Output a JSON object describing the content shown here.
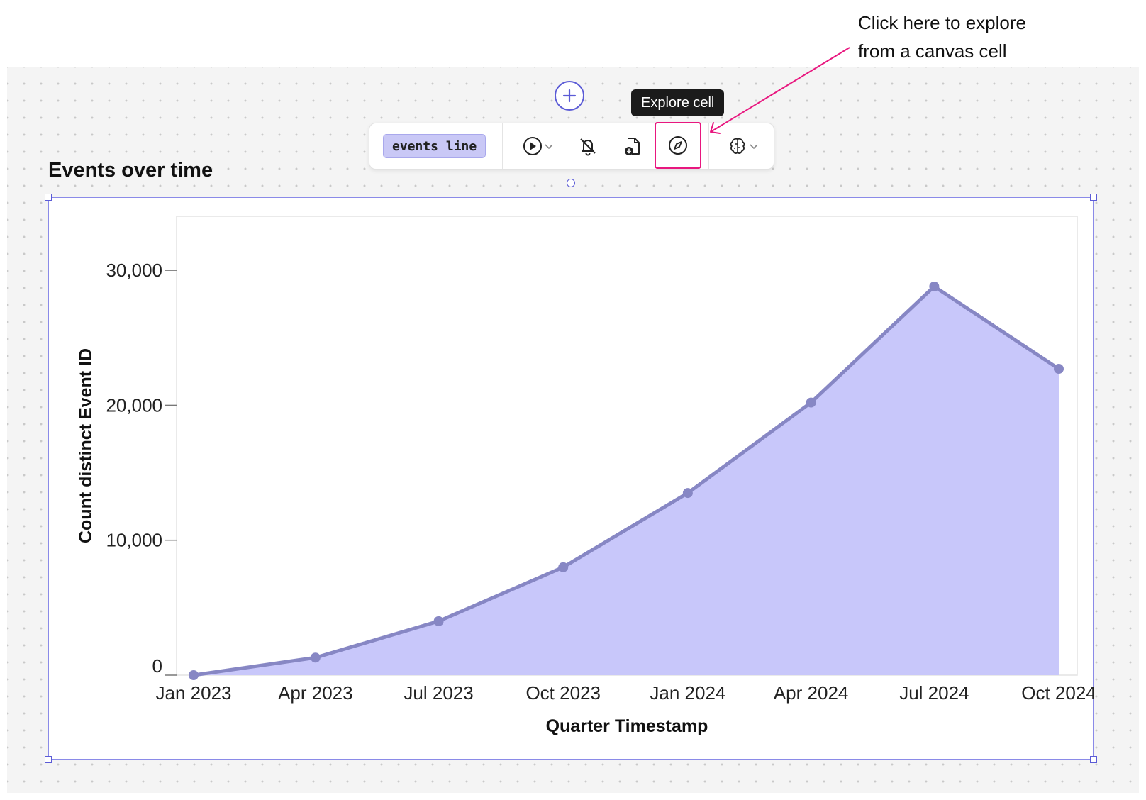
{
  "annotation": {
    "text": "Click here to explore\nfrom a canvas cell",
    "arrow_color": "#e8177f"
  },
  "toolbar": {
    "cell_name": "events line",
    "tooltip": "Explore cell",
    "buttons": [
      {
        "name": "run-icon",
        "has_dropdown": true
      },
      {
        "name": "bell-off-icon",
        "has_dropdown": false
      },
      {
        "name": "download-file-icon",
        "has_dropdown": false
      },
      {
        "name": "explore-compass-icon",
        "has_dropdown": false,
        "highlighted": true
      },
      {
        "name": "brain-ai-icon",
        "has_dropdown": true
      }
    ]
  },
  "cell": {
    "title": "Events over time"
  },
  "colors": {
    "accent": "#5b5bd6",
    "area_fill": "#c8c7fa",
    "line": "#8787c4",
    "highlight": "#e8177f"
  },
  "chart_data": {
    "type": "area",
    "xlabel": "Quarter Timestamp",
    "ylabel": "Count distinct Event ID",
    "x": [
      "2023-01-01",
      "2023-04-01",
      "2023-07-01",
      "2023-10-01",
      "2024-01-01",
      "2024-04-01",
      "2024-07-01",
      "2024-10-01"
    ],
    "x_tick_labels": [
      "Jan 2023",
      "Apr 2023",
      "Jul 2023",
      "Oct 2023",
      "Jan 2024",
      "Apr 2024",
      "Jul 2024",
      "Oct 2024"
    ],
    "values": [
      0,
      1300,
      4000,
      8000,
      13500,
      20200,
      28800,
      22700
    ],
    "y_ticks": [
      0,
      10000,
      20000,
      30000
    ],
    "y_tick_labels": [
      "0",
      "10,000",
      "20,000",
      "30,000"
    ],
    "ylim": [
      0,
      34000
    ],
    "grid": false,
    "legend": "none"
  }
}
